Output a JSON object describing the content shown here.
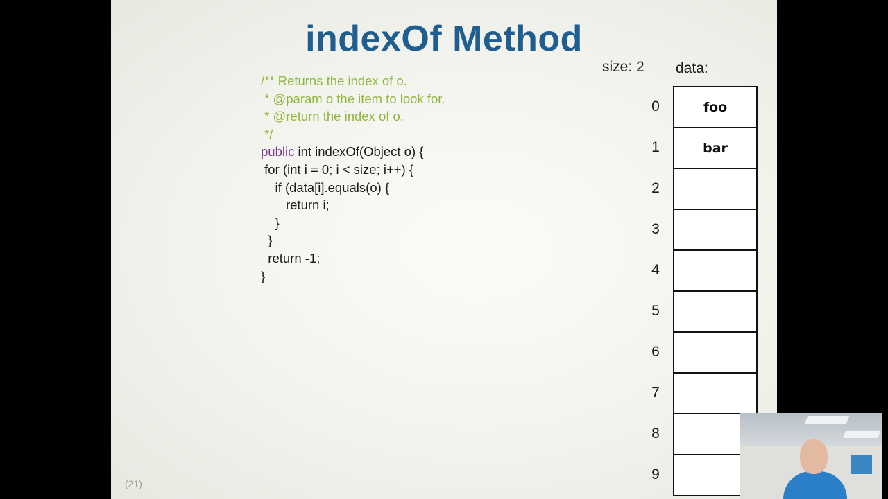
{
  "slide": {
    "title": "indexOf Method",
    "page_number": "(21)"
  },
  "code": {
    "lines": [
      {
        "text": "/** Returns the index of o.",
        "kind": "comment"
      },
      {
        "text": " * @param o the item to look for.",
        "kind": "comment"
      },
      {
        "text": " * @return the index of o.",
        "kind": "comment"
      },
      {
        "text": " */",
        "kind": "comment"
      },
      {
        "keyword": "public",
        "text": " int indexOf(Object o) {",
        "kind": "signature"
      },
      {
        "text": " for (int i = 0; i < size; i++) {",
        "kind": "code"
      },
      {
        "text": "    if (data[i].equals(o) {",
        "kind": "code"
      },
      {
        "text": "       return i;",
        "kind": "code"
      },
      {
        "text": "    }",
        "kind": "code"
      },
      {
        "text": "  }",
        "kind": "code"
      },
      {
        "text": "  return -1;",
        "kind": "code"
      },
      {
        "text": "}",
        "kind": "code"
      }
    ]
  },
  "array_view": {
    "size_label": "size: 2",
    "data_label": "data:",
    "indices": [
      "0",
      "1",
      "2",
      "3",
      "4",
      "5",
      "6",
      "7",
      "8",
      "9"
    ],
    "cells": [
      "foo",
      "bar",
      "",
      "",
      "",
      "",
      "",
      "",
      "",
      ""
    ]
  },
  "colors": {
    "title": "#1f5e8e",
    "comment": "#8fb73e",
    "keyword": "#7a3b8f"
  }
}
